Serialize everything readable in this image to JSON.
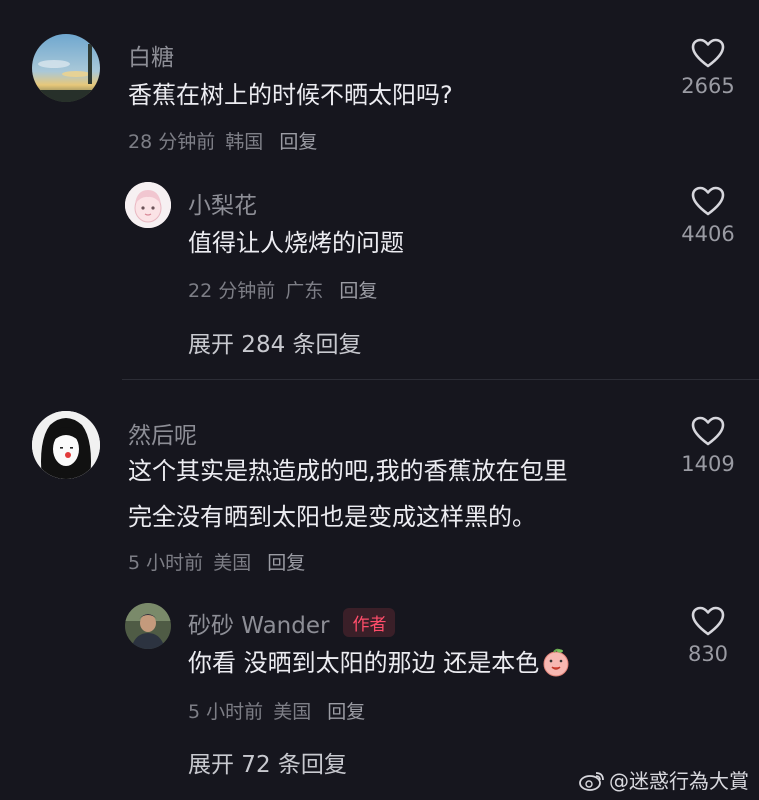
{
  "comments": [
    {
      "user": "白糖",
      "text": "香蕉在树上的时候不晒太阳吗?",
      "time": "28 分钟前",
      "location": "韩国",
      "reply_label": "回复",
      "likes": "2665",
      "avatar_icon": "sky-photo-avatar"
    },
    {
      "user": "小梨花",
      "text": "值得让人烧烤的问题",
      "time": "22 分钟前",
      "location": "广东",
      "reply_label": "回复",
      "likes": "4406",
      "avatar_icon": "pink-cartoon-avatar"
    },
    {
      "user": "然后呢",
      "text_line1": "这个其实是热造成的吧,我的香蕉放在包里",
      "text_line2": "完全没有晒到太阳也是变成这样黑的。",
      "time": "5 小时前",
      "location": "美国",
      "reply_label": "回复",
      "likes": "1409",
      "avatar_icon": "black-hair-girl-avatar"
    },
    {
      "user": "砂砂 Wander",
      "badge": "作者",
      "text": "你看 没晒到太阳的那边 还是本色",
      "time": "5 小时前",
      "location": "美国",
      "reply_label": "回复",
      "likes": "830",
      "avatar_icon": "person-photo-avatar",
      "emoji_icon": "peach-face-emoji"
    }
  ],
  "expand1": "展开 284 条回复",
  "expand2": "展开 72 条回复",
  "watermark": "@迷惑行為大賞",
  "colors": {
    "background": "#16161e",
    "author_badge": "#ff4d6a",
    "muted_text": "#7d7e86"
  }
}
